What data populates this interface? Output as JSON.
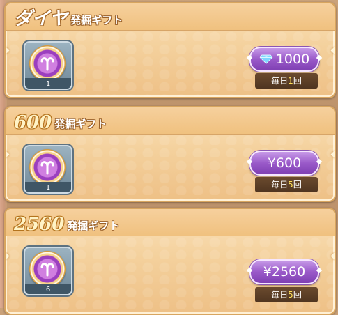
{
  "cards": [
    {
      "title_big": "ダイヤ",
      "title_num": "",
      "title_sub": "発掘ギフト",
      "item_count": "1",
      "price": "1000",
      "price_icon": "diamond-icon",
      "limit_prefix": "毎日",
      "limit_count": "1",
      "limit_suffix": "回"
    },
    {
      "title_big": "",
      "title_num": "600",
      "title_sub": "発掘ギフト",
      "item_count": "1",
      "price": "¥600",
      "price_icon": "",
      "limit_prefix": "毎日",
      "limit_count": "5",
      "limit_suffix": "回"
    },
    {
      "title_big": "",
      "title_num": "2560",
      "title_sub": "発掘ギフト",
      "item_count": "6",
      "price": "¥2560",
      "price_icon": "",
      "limit_prefix": "毎日",
      "limit_count": "5",
      "limit_suffix": "回"
    }
  ],
  "colors": {
    "button": "#9a5ac9",
    "limit_highlight": "#ffe05a",
    "card": "#f4d19d"
  }
}
